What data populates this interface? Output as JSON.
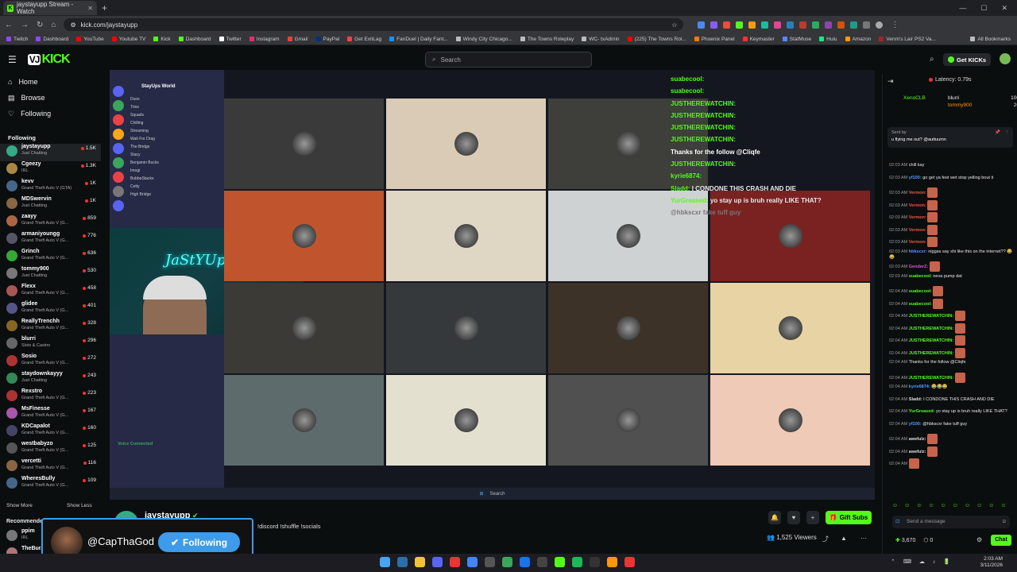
{
  "browser": {
    "tab_title": "jaystayupp Stream - Watch",
    "url": "kick.com/jaystayupp",
    "bookmarks": [
      "Twitch",
      "Dashboard",
      "YouTube",
      "Youtube TV",
      "Kick",
      "Dashboard",
      "Twitter",
      "Instagram",
      "Gmail",
      "PayPal",
      "Get ExitLag",
      "FanDuel | Daily Fant...",
      "Windy City Chicago...",
      "The Towns Roleplay",
      "WC- txAdmin",
      "(225) The Towns Rol...",
      "Phoenix Panel",
      "Keymaster",
      "StatMuse",
      "Hulu",
      "Amazon",
      "Venm's Lair PS2 Va..."
    ],
    "all_bookmarks": "All Bookmarks"
  },
  "header": {
    "logo": "KICK",
    "search_placeholder": "Search",
    "get_kicks": "Get KICKs"
  },
  "sidebar": {
    "nav": [
      {
        "label": "Home",
        "icon": "home-icon"
      },
      {
        "label": "Browse",
        "icon": "browse-icon"
      },
      {
        "label": "Following",
        "icon": "heart-icon"
      }
    ],
    "following_title": "Following",
    "channels": [
      {
        "name": "jaystayupp",
        "game": "Just Chatting",
        "viewers": "1.5K",
        "color": "#3a8"
      },
      {
        "name": "Cgeezy",
        "game": "IRL",
        "viewers": "1.3K",
        "color": "#a84"
      },
      {
        "name": "kevv",
        "game": "Grand Theft Auto V (GTA)",
        "viewers": "1K",
        "color": "#468"
      },
      {
        "name": "MDSwervin",
        "game": "Just Chatting",
        "viewers": "1K",
        "color": "#864"
      },
      {
        "name": "zaayy",
        "game": "Grand Theft Auto V (G...",
        "viewers": "859",
        "color": "#a64"
      },
      {
        "name": "armaniyoungg",
        "game": "Grand Theft Auto V (G...",
        "viewers": "776",
        "color": "#556"
      },
      {
        "name": "Grinch",
        "game": "Grand Theft Auto V (G...",
        "viewers": "636",
        "color": "#3a3"
      },
      {
        "name": "tommy900",
        "game": "Just Chatting",
        "viewers": "530",
        "color": "#777"
      },
      {
        "name": "Flexx",
        "game": "Grand Theft Auto V (G...",
        "viewers": "458",
        "color": "#a55"
      },
      {
        "name": "glidee",
        "game": "Grand Theft Auto V (G...",
        "viewers": "401",
        "color": "#558"
      },
      {
        "name": "ReallyTrenchh",
        "game": "Grand Theft Auto V (G...",
        "viewers": "328",
        "color": "#862"
      },
      {
        "name": "blurri",
        "game": "Slots & Casino",
        "viewers": "296",
        "color": "#666"
      },
      {
        "name": "Sosio",
        "game": "Grand Theft Auto V (G...",
        "viewers": "272",
        "color": "#a33"
      },
      {
        "name": "staydownkayyy",
        "game": "Just Chatting",
        "viewers": "243",
        "color": "#385"
      },
      {
        "name": "Rexstro",
        "game": "Grand Theft Auto V (G...",
        "viewers": "223",
        "color": "#a33"
      },
      {
        "name": "MsFinesse",
        "game": "Grand Theft Auto V (G...",
        "viewers": "167",
        "color": "#a5a"
      },
      {
        "name": "KDCapalot",
        "game": "Grand Theft Auto V (G...",
        "viewers": "160",
        "color": "#446"
      },
      {
        "name": "westbabyzo",
        "game": "Grand Theft Auto V (G...",
        "viewers": "125",
        "color": "#555"
      },
      {
        "name": "vercetti",
        "game": "Grand Theft Auto V (G...",
        "viewers": "116",
        "color": "#864"
      },
      {
        "name": "WheresBully",
        "game": "Grand Theft Auto V (G...",
        "viewers": "109",
        "color": "#468"
      }
    ],
    "show_more": "Show More",
    "show_less": "Show Less",
    "recommended_title": "Recommended",
    "recommended": [
      {
        "name": "ppim",
        "game": "IRL"
      },
      {
        "name": "TheBur...",
        "game": ""
      }
    ]
  },
  "video": {
    "discord_server": "StayUps World",
    "discord_items": [
      "Duos",
      "Trios",
      "Squads",
      "Chilling",
      "Streaming",
      "Wait For Drag",
      "The Bridge",
      "Stacy",
      "Benjamin Bucks",
      "Imogi",
      "BubbaStacks",
      "Cetty",
      "High Bridge"
    ],
    "voice_connected": "Voice Connected",
    "overlay_chat": [
      {
        "user": "suabecool:",
        "text": ""
      },
      {
        "user": "suabecool:",
        "text": ""
      },
      {
        "user": "JUSTHEREWATCHIN:",
        "text": ""
      },
      {
        "user": "JUSTHEREWATCHIN:",
        "text": ""
      },
      {
        "user": "JUSTHEREWATCHIN:",
        "text": ""
      },
      {
        "user": "JUSTHEREWATCHIN:",
        "text": ""
      },
      {
        "user": "",
        "text": "Thanks for the follow @Cliqfe"
      },
      {
        "user": "JUSTHEREWATCHIN:",
        "text": ""
      },
      {
        "user": "kyrie6874:",
        "text": ""
      },
      {
        "user": "Sladd:",
        "text": "I CONDONE THIS CRASH AND DIE"
      },
      {
        "user": "YurGreased:",
        "text": "yo stay up is bruh really LIKE THAT?"
      },
      {
        "user": "",
        "text": "@hbkscxr fake tuff guy"
      }
    ],
    "taskbar_search": "Search"
  },
  "stream_info": {
    "streamer": "jaystayupp",
    "tags": "!discord !shuffle !socials",
    "gift_subs": "Gift Subs",
    "viewers": "1,525 Viewers"
  },
  "follow_alert": {
    "name": "@CapThaGod",
    "button": "Following"
  },
  "chat": {
    "latency": "Latency: 0.79s",
    "top_gifters": [
      {
        "name": "XenoCLB",
        "n": "",
        "v": ""
      },
      {
        "name": "blurri",
        "v": "100"
      },
      {
        "name": "tommy900",
        "v": "26"
      }
    ],
    "pinned_by": "Sent by",
    "pinned_text": "u flying me out? @auttuumn",
    "messages": [
      {
        "t": "02:03 AM",
        "u": "",
        "c": "#ccc",
        "m": "chill kay"
      },
      {
        "t": "02:03 AM",
        "u": "yf100:",
        "c": "#59f",
        "m": "go get ya feet wet stop yelling bout it"
      },
      {
        "t": "02:03 AM",
        "u": "Vermon:",
        "c": "#e54",
        "m": ""
      },
      {
        "t": "02:03 AM",
        "u": "Vermon:",
        "c": "#e54",
        "m": ""
      },
      {
        "t": "02:03 AM",
        "u": "Vermon:",
        "c": "#e54",
        "m": ""
      },
      {
        "t": "02:03 AM",
        "u": "Vermon:",
        "c": "#e54",
        "m": ""
      },
      {
        "t": "02:03 AM",
        "u": "Vermon:",
        "c": "#e54",
        "m": ""
      },
      {
        "t": "02:03 AM",
        "u": "hbkscxr:",
        "c": "#59f",
        "m": "niggas say shi like this on the internet?? 😂😂"
      },
      {
        "t": "02:03 AM",
        "u": "GenderZ:",
        "c": "#d5d",
        "m": ""
      },
      {
        "t": "02:03 AM",
        "u": "suabecool:",
        "c": "#53fc18",
        "m": "neva pump dat"
      },
      {
        "t": "02:04 AM",
        "u": "suabecool:",
        "c": "#53fc18",
        "m": ""
      },
      {
        "t": "02:04 AM",
        "u": "suabecool:",
        "c": "#53fc18",
        "m": ""
      },
      {
        "t": "02:04 AM",
        "u": "JUSTHEREWATCHIN:",
        "c": "#53fc18",
        "m": ""
      },
      {
        "t": "02:04 AM",
        "u": "JUSTHEREWATCHIN:",
        "c": "#53fc18",
        "m": ""
      },
      {
        "t": "02:04 AM",
        "u": "JUSTHEREWATCHIN:",
        "c": "#53fc18",
        "m": ""
      },
      {
        "t": "02:04 AM",
        "u": "JUSTHEREWATCHIN:",
        "c": "#53fc18",
        "m": ""
      },
      {
        "t": "02:04 AM",
        "u": "",
        "c": "#e33",
        "m": "Thanks for the follow @Cliqfe"
      },
      {
        "t": "02:04 AM",
        "u": "JUSTHEREWATCHIN:",
        "c": "#53fc18",
        "m": ""
      },
      {
        "t": "02:04 AM",
        "u": "kyrie6874:",
        "c": "#59f",
        "m": "😂😂😂"
      },
      {
        "t": "02:04 AM",
        "u": "Sladd:",
        "c": "#ddd",
        "m": "I CONDONE THIS CRASH AND DIE"
      },
      {
        "t": "02:04 AM",
        "u": "YurGreased:",
        "c": "#53fc18",
        "m": "yo stay up is bruh really LIKE THAT?"
      },
      {
        "t": "02:04 AM",
        "u": "yf100:",
        "c": "#59f",
        "m": "@hbkscxr fake tuff guy"
      },
      {
        "t": "02:04 AM",
        "u": "awefulz:",
        "c": "#ddd",
        "m": ""
      },
      {
        "t": "02:04 AM",
        "u": "awefulz:",
        "c": "#ddd",
        "m": ""
      },
      {
        "t": "02:04 AM",
        "u": "",
        "c": "#e33",
        "m": ""
      }
    ],
    "input_placeholder": "Send a message",
    "kicks_count": "3,670",
    "zero": "0",
    "chat_button": "Chat"
  },
  "os": {
    "time": "2:03 AM",
    "date": "3/11/2026"
  }
}
